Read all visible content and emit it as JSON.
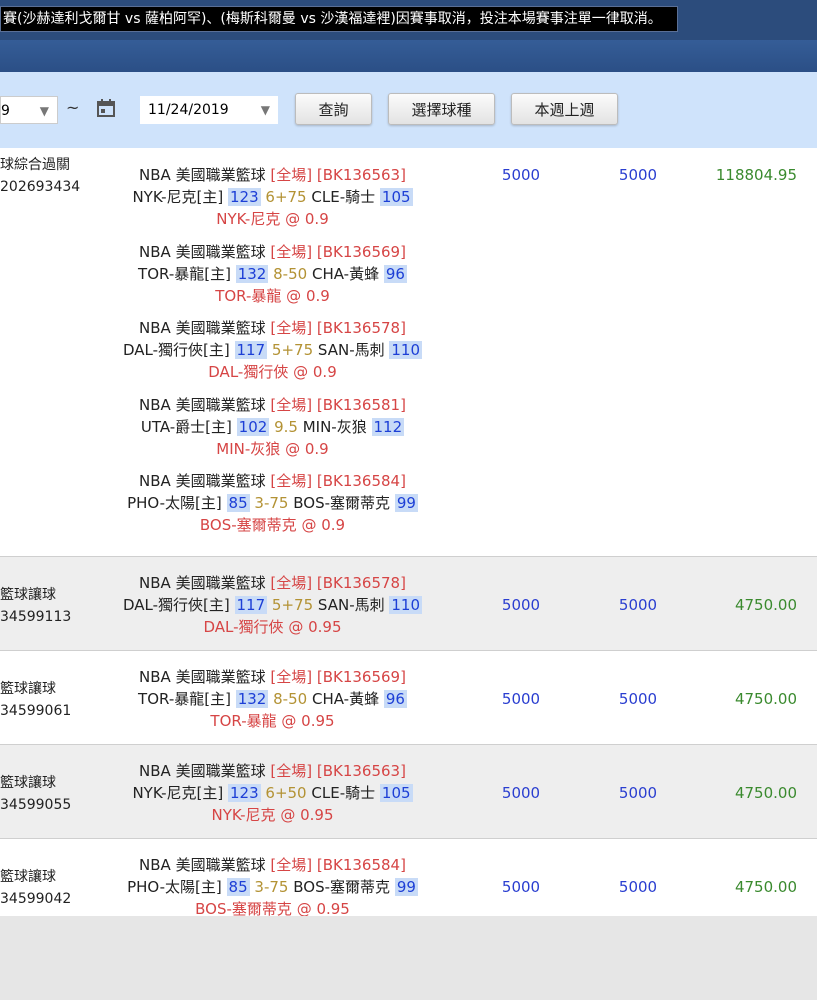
{
  "ticker": {
    "text": "賽(沙赫達利戈爾甘 vs 薩柏阿罕)、(梅斯科爾曼 vs 沙漢福達裡)因賽事取消，投注本場賽事注單一律取消。"
  },
  "filters": {
    "date_from": "9",
    "tilde": "~",
    "date_to": "11/24/2019",
    "buttons": {
      "query": "查詢",
      "select_sport": "選擇球種",
      "this_last_week": "本週上週"
    }
  },
  "parlay": {
    "type_label": "球綜合過關",
    "ticket_id": "202693434",
    "stake": "5000",
    "valid": "5000",
    "win": "118804.95",
    "legs": [
      {
        "league": "NBA 美國職業籃球",
        "period": "[全場]",
        "code": "[BK136563]",
        "home": "NYK-尼克[主]",
        "home_score": "123",
        "line": "6+75",
        "away": "CLE-騎士",
        "away_score": "105",
        "pick": "NYK-尼克",
        "odds": "@ 0.9"
      },
      {
        "league": "NBA 美國職業籃球",
        "period": "[全場]",
        "code": "[BK136569]",
        "home": "TOR-暴龍[主]",
        "home_score": "132",
        "line": "8-50",
        "away": "CHA-黃蜂",
        "away_score": "96",
        "pick": "TOR-暴龍",
        "odds": "@ 0.9"
      },
      {
        "league": "NBA 美國職業籃球",
        "period": "[全場]",
        "code": "[BK136578]",
        "home": "DAL-獨行俠[主]",
        "home_score": "117",
        "line": "5+75",
        "away": "SAN-馬刺",
        "away_score": "110",
        "pick": "DAL-獨行俠",
        "odds": "@ 0.9"
      },
      {
        "league": "NBA 美國職業籃球",
        "period": "[全場]",
        "code": "[BK136581]",
        "home": "UTA-爵士[主]",
        "home_score": "102",
        "line": "9.5",
        "away": "MIN-灰狼",
        "away_score": "112",
        "pick": "MIN-灰狼",
        "odds": "@ 0.9"
      },
      {
        "league": "NBA 美國職業籃球",
        "period": "[全場]",
        "code": "[BK136584]",
        "home": "PHO-太陽[主]",
        "home_score": "85",
        "line": "3-75",
        "away": "BOS-塞爾蒂克",
        "away_score": "99",
        "pick": "BOS-塞爾蒂克",
        "odds": "@ 0.9"
      }
    ]
  },
  "singles": [
    {
      "type_label": "籃球讓球",
      "ticket_id": "34599113",
      "league": "NBA 美國職業籃球",
      "period": "[全場]",
      "code": "[BK136578]",
      "home": "DAL-獨行俠[主]",
      "home_score": "117",
      "line": "5+75",
      "away": "SAN-馬刺",
      "away_score": "110",
      "pick": "DAL-獨行俠",
      "odds": "@ 0.95",
      "stake": "5000",
      "valid": "5000",
      "win": "4750.00"
    },
    {
      "type_label": "籃球讓球",
      "ticket_id": "34599061",
      "league": "NBA 美國職業籃球",
      "period": "[全場]",
      "code": "[BK136569]",
      "home": "TOR-暴龍[主]",
      "home_score": "132",
      "line": "8-50",
      "away": "CHA-黃蜂",
      "away_score": "96",
      "pick": "TOR-暴龍",
      "odds": "@ 0.95",
      "stake": "5000",
      "valid": "5000",
      "win": "4750.00"
    },
    {
      "type_label": "籃球讓球",
      "ticket_id": "34599055",
      "league": "NBA 美國職業籃球",
      "period": "[全場]",
      "code": "[BK136563]",
      "home": "NYK-尼克[主]",
      "home_score": "123",
      "line": "6+50",
      "away": "CLE-騎士",
      "away_score": "105",
      "pick": "NYK-尼克",
      "odds": "@ 0.95",
      "stake": "5000",
      "valid": "5000",
      "win": "4750.00"
    },
    {
      "type_label": "籃球讓球",
      "ticket_id": "34599042",
      "league": "NBA 美國職業籃球",
      "period": "[全場]",
      "code": "[BK136584]",
      "home": "PHO-太陽[主]",
      "home_score": "85",
      "line": "3-75",
      "away": "BOS-塞爾蒂克",
      "away_score": "99",
      "pick": "BOS-塞爾蒂克",
      "odds": "@ 0.95",
      "stake": "5000",
      "valid": "5000",
      "win": "4750.00"
    }
  ]
}
